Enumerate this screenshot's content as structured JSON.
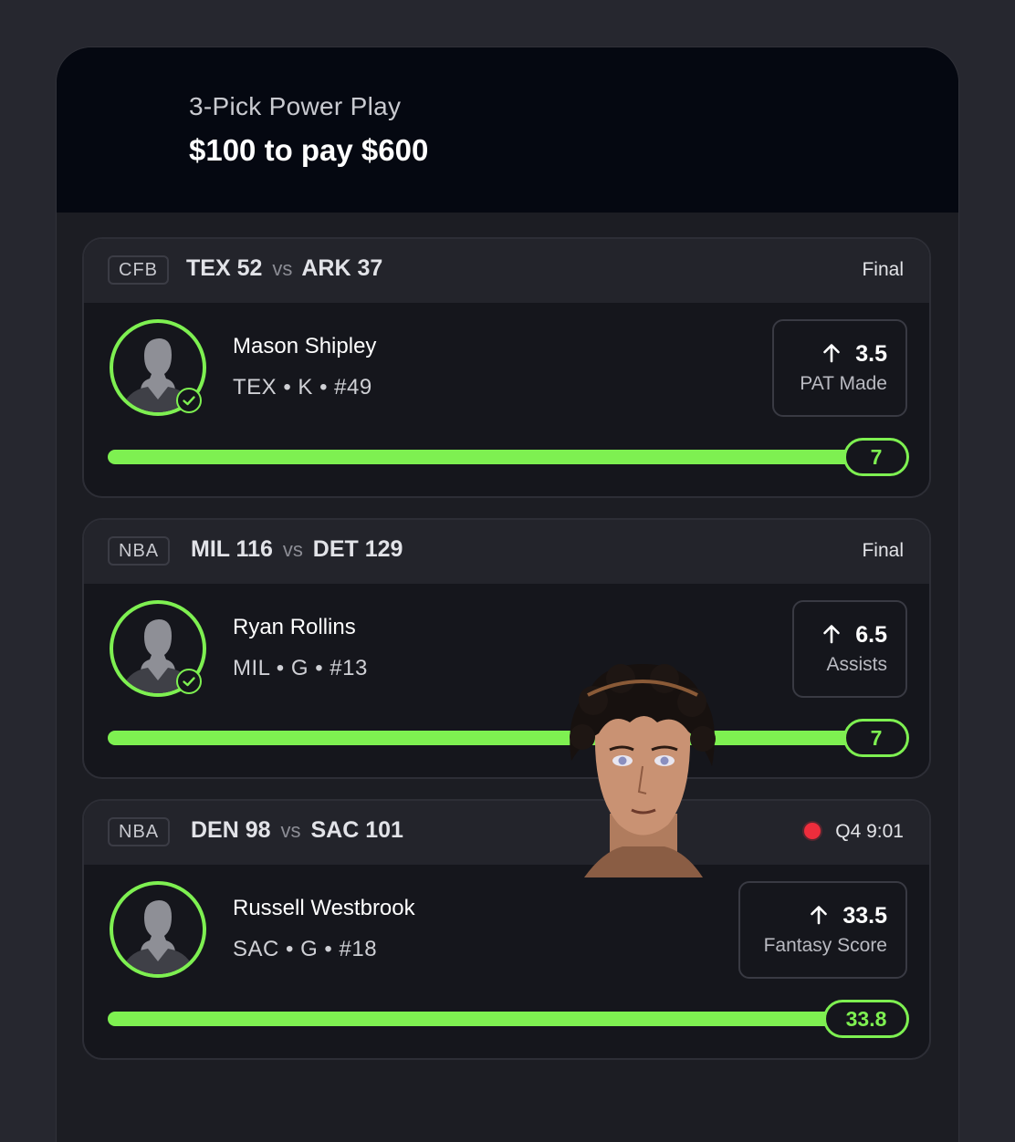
{
  "header": {
    "subtitle": "3-Pick Power Play",
    "title": "$100 to pay $600"
  },
  "picks": [
    {
      "league": "CFB",
      "home_team": "TEX",
      "home_score": "52",
      "vs": "vs",
      "away_team": "ARK",
      "away_score": "37",
      "status": "Final",
      "live": false,
      "player_name": "Mason Shipley",
      "player_meta": "TEX • K • #49",
      "line": "3.5",
      "stat": "PAT Made",
      "direction": "up-arrow-icon",
      "result": "7",
      "progress": 1.0,
      "hit": true
    },
    {
      "league": "NBA",
      "home_team": "MIL",
      "home_score": "116",
      "vs": "vs",
      "away_team": "DET",
      "away_score": "129",
      "status": "Final",
      "live": false,
      "player_name": "Ryan Rollins",
      "player_meta": "MIL • G • #13",
      "line": "6.5",
      "stat": "Assists",
      "direction": "up-arrow-icon",
      "result": "7",
      "progress": 1.0,
      "hit": true
    },
    {
      "league": "NBA",
      "home_team": "DEN",
      "home_score": "98",
      "vs": "vs",
      "away_team": "SAC",
      "away_score": "101",
      "status": "Q4 9:01",
      "live": true,
      "player_name": "Russell Westbrook",
      "player_meta": "SAC • G • #18",
      "line": "33.5",
      "stat": "Fantasy Score",
      "direction": "up-arrow-icon",
      "result": "33.8",
      "progress": 1.0,
      "hit": false
    }
  ],
  "colors": {
    "accent": "#7ef051",
    "live": "#ee2d3c",
    "background": "#26272f",
    "header": "#050811"
  }
}
